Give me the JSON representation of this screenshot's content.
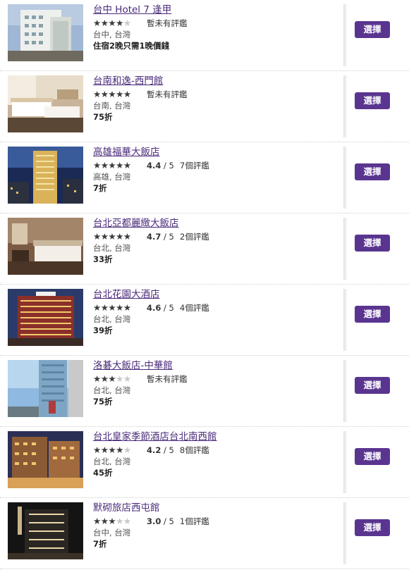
{
  "select_label": "選擇",
  "colors": {
    "accent": "#5a3590",
    "link": "#4a2a7a"
  },
  "hotels": [
    {
      "name": "台中 Hotel 7 逢甲",
      "stars": 4,
      "score": "",
      "score_suffix": "",
      "reviews": "暫未有評鑑",
      "location": "台中, 台灣",
      "deal": "住宿2晚只需1晚價錢",
      "image": "hotel-7-fengjia-photo"
    },
    {
      "name": "台南和逸-西門館",
      "stars": 5,
      "score": "",
      "score_suffix": "",
      "reviews": "暫未有評鑑",
      "location": "台南, 台灣",
      "deal": "75折",
      "image": "cozzi-ximen-room-photo"
    },
    {
      "name": "高雄福華大飯店",
      "stars": 5,
      "score": "4.4",
      "score_suffix": " / 5",
      "reviews": "7個評鑑",
      "location": "高雄, 台灣",
      "deal": "7折",
      "image": "howard-kaohsiung-night-photo"
    },
    {
      "name": "台北亞都麗緻大飯店",
      "stars": 5,
      "score": "4.7",
      "score_suffix": " / 5",
      "reviews": "2個評鑑",
      "location": "台北, 台灣",
      "deal": "33折",
      "image": "landis-taipei-room-photo"
    },
    {
      "name": "台北花園大酒店",
      "stars": 5,
      "score": "4.6",
      "score_suffix": " / 5",
      "reviews": "4個評鑑",
      "location": "台北, 台灣",
      "deal": "39折",
      "image": "taipei-garden-hotel-photo"
    },
    {
      "name": "洛碁大飯店-中華館",
      "stars": 3,
      "score": "",
      "score_suffix": "",
      "reviews": "暫未有評鑑",
      "location": "台北, 台灣",
      "deal": "75折",
      "image": "green-world-zhonghua-photo"
    },
    {
      "name": "台北皇家季節酒店台北南西館",
      "stars": 4,
      "score": "4.2",
      "score_suffix": " / 5",
      "reviews": "8個評鑑",
      "location": "台北, 台灣",
      "deal": "45折",
      "image": "royal-seasons-nanxi-photo"
    },
    {
      "name": "默砌旅店西屯館",
      "stars": 3,
      "score": "3.0",
      "score_suffix": " / 5",
      "reviews": "1個評鑑",
      "location": "台中, 台灣",
      "deal": "7折",
      "image": "moxi-hotel-xitun-photo"
    }
  ]
}
